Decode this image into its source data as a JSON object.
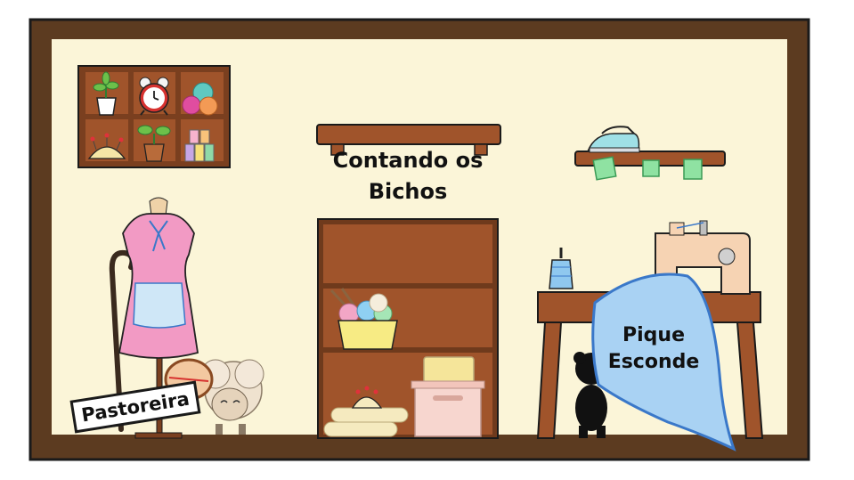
{
  "scene": {
    "title_line1": "Contando os",
    "title_line2": "Bichos",
    "pique_line1": "Pique",
    "pique_line2": "Esconde",
    "sign_text": "Pastoreira"
  },
  "colors": {
    "frame": "#5c3b20",
    "wall": "#fbf5d8",
    "wood": "#a0542b",
    "wood_dark": "#6f3a1c",
    "dress_pink": "#f29ac4",
    "apron_blue": "#cfe7f7",
    "cloth_blue": "#a9d2f3",
    "cloth_border": "#3a78c9",
    "machine": "#f6d3b3",
    "yarn_pink": "#e04da0",
    "yarn_orange": "#f39a55",
    "yarn_teal": "#5fc9c0",
    "sheep_wool": "#efe2cf"
  },
  "icons": [
    "plant-icon",
    "alarm-clock-icon",
    "yarn-balls-icon",
    "pincushion-icon",
    "sprout-pot-icon",
    "thread-spools-icon",
    "iron-icon",
    "sewing-machine-icon",
    "dress-form-icon",
    "shepherd-crook-icon",
    "sheep-icon",
    "yarn-basket-icon",
    "fabric-bolts-icon",
    "storage-box-icon",
    "thread-cone-icon",
    "hidden-silhouette-icon"
  ]
}
